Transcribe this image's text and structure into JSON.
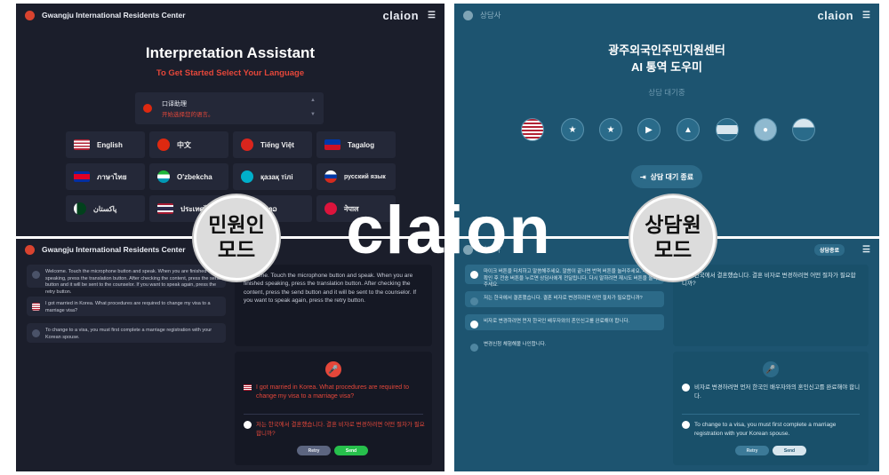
{
  "resident_mode": {
    "header_title": "Gwangju International Residents Center",
    "brand": "claion",
    "menu_icon": "hamburger-icon",
    "title": "Interpretation Assistant",
    "subtitle": "To Get Started Select Your Language",
    "selector": {
      "line1": "口译助理",
      "line2": "开始选择您的语言。"
    },
    "languages": [
      {
        "label": "English",
        "flag": "us"
      },
      {
        "label": "中文",
        "flag": "cn"
      },
      {
        "label": "Tiếng Việt",
        "flag": "vn"
      },
      {
        "label": "Tagalog",
        "flag": "ph"
      },
      {
        "label": "ภาษาไทย",
        "flag": "kh"
      },
      {
        "label": "O'zbekcha",
        "flag": "uz"
      },
      {
        "label": "қазақ тілі",
        "flag": "kz"
      },
      {
        "label": "русский язык",
        "flag": "ru"
      },
      {
        "label": "پاکستان",
        "flag": "pk"
      },
      {
        "label": "ประเทศไทย",
        "flag": "th"
      },
      {
        "label": "ລາວ",
        "flag": "la"
      },
      {
        "label": "नेपाल",
        "flag": "np"
      }
    ],
    "chat_header_title": "Gwangju International Residents Center",
    "chat_messages": [
      "Welcome. Touch the microphone button and speak. When you are finished speaking, press the translation button. After checking the content, press the send button and it will be sent to the counselor. If you want to speak again, press the retry button.",
      "I got married in Korea. What procedures are required to change my visa to a marriage visa?",
      "To change to a visa, you must first complete a marriage registration with your Korean spouse."
    ],
    "welcome_text": "Welcome. Touch the microphone button and speak. When you are finished speaking, press the translation button. After checking the content, press the send button and it will be sent to the counselor. If you want to speak again, press the retry button.",
    "question_en": "I got married in Korea. What procedures are required to change my visa to a marriage visa?",
    "question_ko": "저는 한국에서 결혼했습니다. 결혼 비자로 변경하려면 어떤 절차가 필요합니까?",
    "retry": "Retry",
    "send": "Send"
  },
  "counselor_mode": {
    "header_title": "상담사",
    "brand": "claion",
    "title_line1": "광주외국인주민지원센터",
    "title_line2": "AI 통역 도우미",
    "status": "상담 대기중",
    "end_button": "상담 대기 종료",
    "chat_header_title": "상담사",
    "end_chip": "상담종료",
    "chat_messages": [
      "마이크 버튼을 터치하고 말씀해주세요. 말씀이 끝나면 번역 버튼을 눌러주세요. 내용을 확인 후 전송 버튼을 누르면 상담사에게 전달됩니다. 다시 말하려면 재시도 버튼을 눌러주세요.",
      "저는 한국에서 결혼했습니다. 결혼 비자로 변경하려면 어떤 절차가 필요합니까?",
      "비자로 변경하려면 먼저 한국인 배우자와의 혼인신고를 완료해야 합니다.",
      "변경신청 체험해볼 나인합니다."
    ],
    "question_ko": "저는 한국에서 결혼했습니다. 결혼 비자로 변경하려면 어떤 절차가 필요합니까?",
    "answer_ko": "비자로 변경하려면 먼저 한국인 배우자와의 혼인신고를 완료해야 합니다.",
    "answer_en": "To change to a visa, you must first complete a marriage registration with your Korean spouse.",
    "retry": "Retry",
    "send": "Send"
  },
  "badges": {
    "resident_line1": "민원인",
    "resident_line2": "모드",
    "counselor_line1": "상담원",
    "counselor_line2": "모드"
  },
  "center_logo": "claion",
  "colors": {
    "resident_bg": "#1b1e2b",
    "counselor_bg": "#1d5470",
    "accent_red": "#e4473a",
    "send_green": "#27c04c"
  }
}
